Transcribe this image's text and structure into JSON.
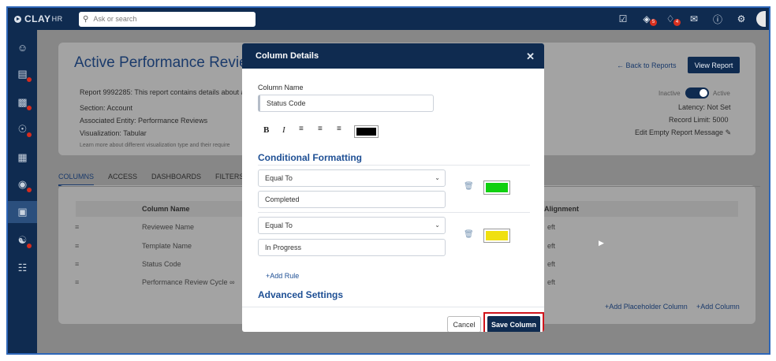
{
  "app": {
    "logo": "CLAY",
    "logo_suffix": "HR"
  },
  "search": {
    "placeholder": "Ask or search"
  },
  "topbar": {
    "badges": {
      "layers": "5",
      "bell": "4"
    }
  },
  "page": {
    "title": "Active Performance Revie",
    "report_desc": "Report 9992285: This report contains details about a",
    "section": "Section: Account",
    "entity": "Associated Entity: Performance Reviews",
    "visualization": "Visualization: Tabular",
    "learn_more": "Learn more about different visualization type and their require",
    "back_link": "← Back to Reports",
    "view_report": "View Report",
    "inactive": "Inactive",
    "active": "Active",
    "latency": "Latency: Not Set",
    "record_limit": "Record Limit: 5000",
    "edit_empty": "Edit Empty Report Message"
  },
  "tabs": [
    "COLUMNS",
    "ACCESS",
    "DASHBOARDS",
    "FILTERS"
  ],
  "table": {
    "col_name": "Column Name",
    "col_align": "Alignment",
    "rows": [
      {
        "name": "Reviewee Name",
        "align": "eft"
      },
      {
        "name": "Template Name",
        "align": "eft"
      },
      {
        "name": "Status Code",
        "align": "eft"
      },
      {
        "name": "Performance Review Cycle",
        "align": "eft"
      }
    ],
    "add_placeholder": "+Add Placeholder Column",
    "add_column": "+Add Column"
  },
  "modal": {
    "title": "Column Details",
    "column_name_label": "Column Name",
    "column_name_value": "Status Code",
    "format": {
      "bold": "B",
      "italic": "I",
      "color": "#000000"
    },
    "conditional_title": "Conditional Formatting",
    "rules": [
      {
        "operator": "Equal To",
        "value": "Completed",
        "color": "#10d010"
      },
      {
        "operator": "Equal To",
        "value": "In Progress",
        "color": "#f0e010"
      }
    ],
    "add_rule": "+Add Rule",
    "advanced_title": "Advanced Settings",
    "cancel": "Cancel",
    "save": "Save Column"
  }
}
